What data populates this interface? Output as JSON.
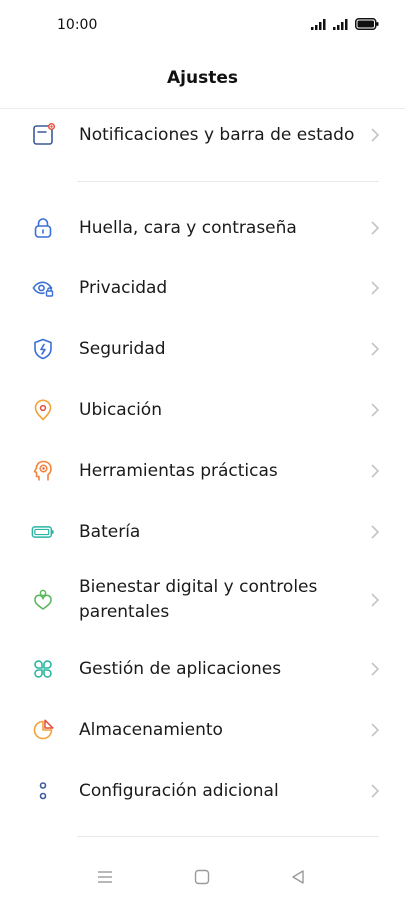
{
  "status_bar": {
    "time": "10:00"
  },
  "header": {
    "title": "Ajustes"
  },
  "items": [
    {
      "label": "Notificaciones y barra de estado",
      "icon": "notification-icon",
      "color": "#3d5a99"
    },
    {
      "label": "Huella, cara y contraseña",
      "icon": "lock-icon",
      "color": "#3a6fd8"
    },
    {
      "label": "Privacidad",
      "icon": "privacy-eye-icon",
      "color": "#3a6fd8"
    },
    {
      "label": "Seguridad",
      "icon": "shield-icon",
      "color": "#3a6fd8"
    },
    {
      "label": "Ubicación",
      "icon": "location-icon",
      "color": "#f2a33a"
    },
    {
      "label": "Herramientas prácticas",
      "icon": "tools-head-icon",
      "color": "#f2843a"
    },
    {
      "label": "Batería",
      "icon": "battery-icon",
      "color": "#2bb5a0"
    },
    {
      "label": "Bienestar digital y controles parentales",
      "icon": "heart-person-icon",
      "color": "#5cb85c"
    },
    {
      "label": "Gestión de aplicaciones",
      "icon": "apps-icon",
      "color": "#2bb5a0"
    },
    {
      "label": "Almacenamiento",
      "icon": "storage-pie-icon",
      "color": "#f2a33a"
    },
    {
      "label": "Configuración adicional",
      "icon": "more-settings-icon",
      "color": "#3d5a99"
    }
  ],
  "accent_colors": {
    "red_dot": "#e74c3c",
    "chevron": "#c4c4c4"
  }
}
